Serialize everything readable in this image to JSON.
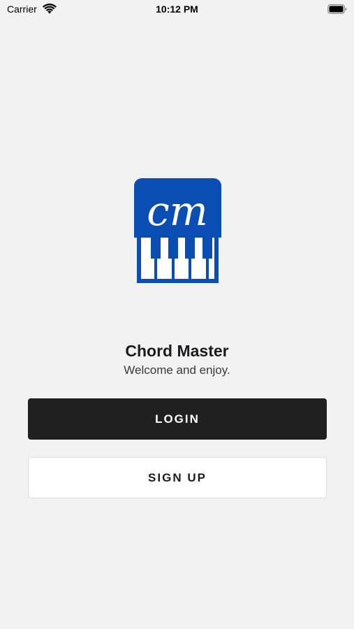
{
  "status_bar": {
    "carrier": "Carrier",
    "time": "10:12 PM",
    "wifi_icon": "wifi-icon",
    "battery_icon": "battery-full-icon"
  },
  "logo": {
    "text": "cm",
    "color": "#0a4db3",
    "icon": "piano-keys-icon"
  },
  "app": {
    "title": "Chord Master",
    "subtitle": "Welcome and enjoy."
  },
  "actions": {
    "login_label": "LOGIN",
    "signup_label": "SIGN UP"
  },
  "colors": {
    "background": "#f2f2f2",
    "login_button": "#202020",
    "signup_button": "#ffffff"
  }
}
